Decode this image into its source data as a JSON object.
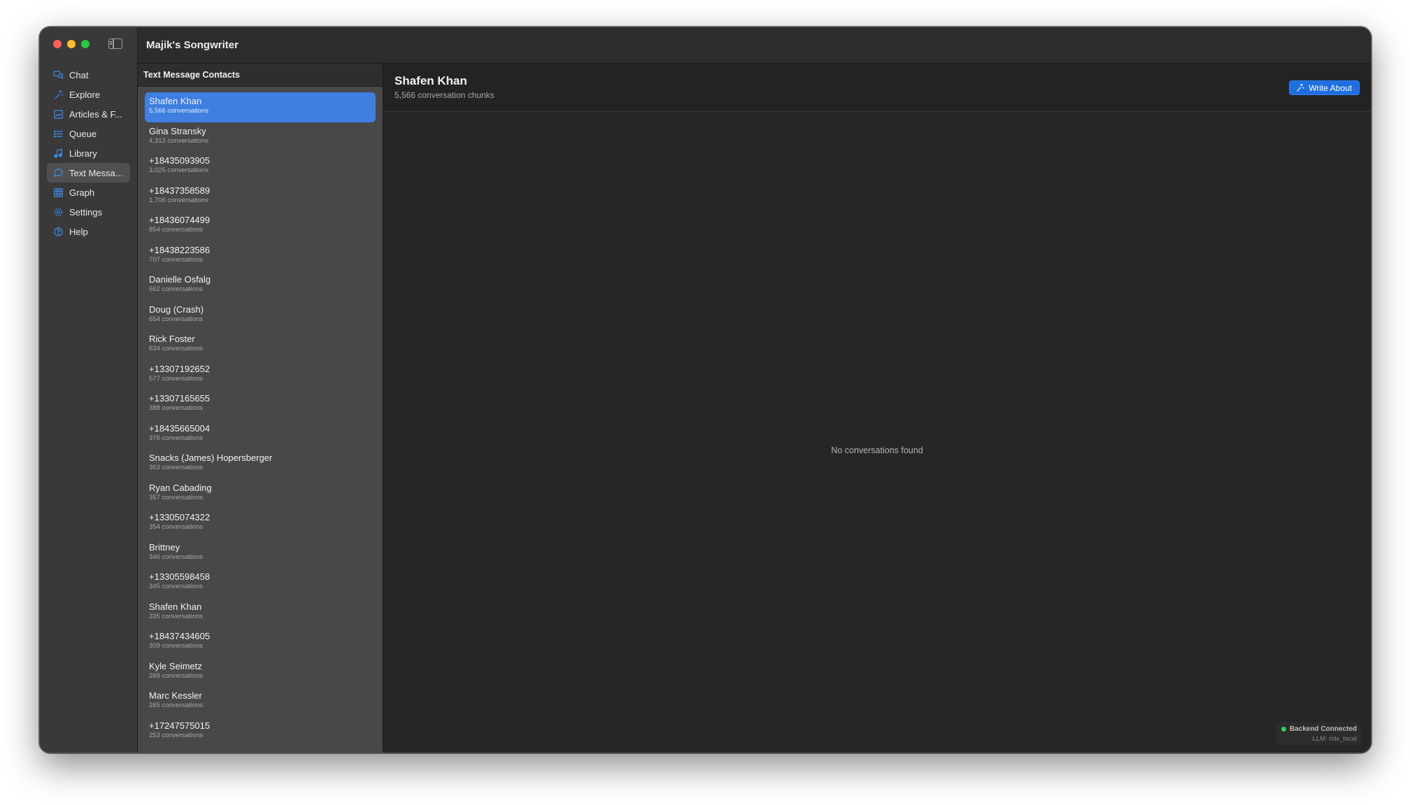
{
  "window": {
    "title": "Majik's Songwriter"
  },
  "sidebar": {
    "items": [
      {
        "label": "Chat",
        "icon": "chat-bubbles-icon"
      },
      {
        "label": "Explore",
        "icon": "sparkles-icon"
      },
      {
        "label": "Articles & F...",
        "icon": "newspaper-icon"
      },
      {
        "label": "Queue",
        "icon": "list-icon"
      },
      {
        "label": "Library",
        "icon": "music-note-icon"
      },
      {
        "label": "Text Messa...",
        "icon": "message-icon",
        "active": true
      },
      {
        "label": "Graph",
        "icon": "grid-icon"
      },
      {
        "label": "Settings",
        "icon": "gear-icon"
      },
      {
        "label": "Help",
        "icon": "question-icon"
      }
    ]
  },
  "contacts": {
    "header": "Text Message Contacts",
    "items": [
      {
        "name": "Shafen Khan",
        "count": "5,566 conversations",
        "selected": true
      },
      {
        "name": "Gina Stransky",
        "count": "4,312 conversations"
      },
      {
        "name": "+18435093905",
        "count": "3,025 conversations"
      },
      {
        "name": "+18437358589",
        "count": "1,706 conversations"
      },
      {
        "name": "+18436074499",
        "count": "854 conversations"
      },
      {
        "name": "+18438223586",
        "count": "707 conversations"
      },
      {
        "name": "Danielle Osfalg",
        "count": "662 conversations"
      },
      {
        "name": "Doug (Crash)",
        "count": "654 conversations"
      },
      {
        "name": "Rick Foster",
        "count": "634 conversations"
      },
      {
        "name": "+13307192652",
        "count": "577 conversations"
      },
      {
        "name": "+13307165655",
        "count": "388 conversations"
      },
      {
        "name": "+18435665004",
        "count": "376 conversations"
      },
      {
        "name": "Snacks (James) Hopersberger",
        "count": "363 conversations"
      },
      {
        "name": "Ryan Cabading",
        "count": "357 conversations"
      },
      {
        "name": "+13305074322",
        "count": "354 conversations"
      },
      {
        "name": "Brittney",
        "count": "346 conversations"
      },
      {
        "name": "+13305598458",
        "count": "345 conversations"
      },
      {
        "name": "Shafen Khan",
        "count": "335 conversations"
      },
      {
        "name": "+18437434605",
        "count": "309 conversations"
      },
      {
        "name": "Kyle Seimetz",
        "count": "269 conversations"
      },
      {
        "name": "Marc Kessler",
        "count": "265 conversations"
      },
      {
        "name": "+17247575015",
        "count": "253 conversations"
      }
    ]
  },
  "detail": {
    "name": "Shafen Khan",
    "subtitle": "5,566 conversation chunks",
    "write_button": "Write About",
    "empty_message": "No conversations found"
  },
  "status": {
    "connection": "Backend Connected",
    "llm": "LLM: mlx_local",
    "dot_color": "#2fd158"
  }
}
